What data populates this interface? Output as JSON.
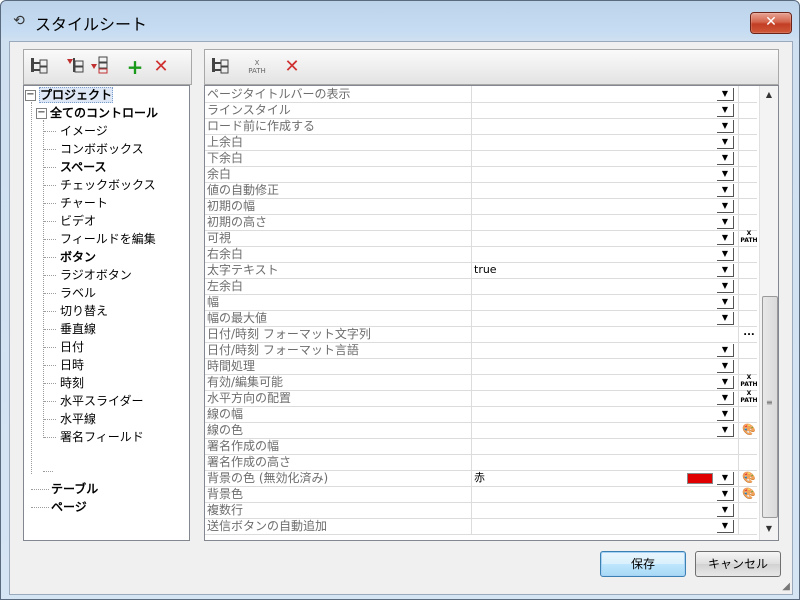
{
  "window": {
    "title": "スタイルシート",
    "close_label": "✕"
  },
  "tree": {
    "root": "プロジェクト",
    "controls_root": "全てのコントロール",
    "controls": [
      "イメージ",
      "コンボボックス",
      "スペース",
      "チェックボックス",
      "チャート",
      "ビデオ",
      "フィールドを編集",
      "ボタン",
      "ラジオボタン",
      "ラベル",
      "切り替え",
      "垂直線",
      "日付",
      "日時",
      "時刻",
      "水平スライダー",
      "水平線",
      "署名フィールド"
    ],
    "bold_controls": [
      "スペース",
      "ボタン"
    ],
    "table": "テーブル",
    "page": "ページ"
  },
  "properties": [
    {
      "name": "ページタイトルバーの表示",
      "value": "",
      "dropdown": true,
      "action": ""
    },
    {
      "name": "ラインスタイル",
      "value": "",
      "dropdown": true,
      "action": ""
    },
    {
      "name": "ロード前に作成する",
      "value": "",
      "dropdown": true,
      "action": ""
    },
    {
      "name": "上余白",
      "value": "",
      "dropdown": true,
      "action": ""
    },
    {
      "name": "下余白",
      "value": "",
      "dropdown": true,
      "action": ""
    },
    {
      "name": "余白",
      "value": "",
      "dropdown": true,
      "action": ""
    },
    {
      "name": "値の自動修正",
      "value": "",
      "dropdown": true,
      "action": ""
    },
    {
      "name": "初期の幅",
      "value": "",
      "dropdown": true,
      "action": ""
    },
    {
      "name": "初期の高さ",
      "value": "",
      "dropdown": true,
      "action": ""
    },
    {
      "name": "可視",
      "value": "",
      "dropdown": true,
      "action": "xpath"
    },
    {
      "name": "右余白",
      "value": "",
      "dropdown": true,
      "action": ""
    },
    {
      "name": "太字テキスト",
      "value": "true",
      "dropdown": true,
      "action": ""
    },
    {
      "name": "左余白",
      "value": "",
      "dropdown": true,
      "action": ""
    },
    {
      "name": "幅",
      "value": "",
      "dropdown": true,
      "action": ""
    },
    {
      "name": "幅の最大値",
      "value": "",
      "dropdown": true,
      "action": ""
    },
    {
      "name": "日付/時刻 フォーマット文字列",
      "value": "",
      "dropdown": false,
      "action": "ellipsis"
    },
    {
      "name": "日付/時刻 フォーマット言語",
      "value": "",
      "dropdown": true,
      "action": ""
    },
    {
      "name": "時間処理",
      "value": "",
      "dropdown": true,
      "action": ""
    },
    {
      "name": "有効/編集可能",
      "value": "",
      "dropdown": true,
      "action": "xpath"
    },
    {
      "name": "水平方向の配置",
      "value": "",
      "dropdown": true,
      "action": "xpath"
    },
    {
      "name": "線の幅",
      "value": "",
      "dropdown": true,
      "action": ""
    },
    {
      "name": "線の色",
      "value": "",
      "dropdown": true,
      "action": "palette"
    },
    {
      "name": "署名作成の幅",
      "value": "",
      "dropdown": false,
      "action": ""
    },
    {
      "name": "署名作成の高さ",
      "value": "",
      "dropdown": false,
      "action": ""
    },
    {
      "name": "背景の色 (無効化済み)",
      "value": "赤",
      "dropdown": true,
      "action": "palette",
      "swatch": "#e00000"
    },
    {
      "name": "背景色",
      "value": "",
      "dropdown": true,
      "action": "palette"
    },
    {
      "name": "複数行",
      "value": "",
      "dropdown": true,
      "action": ""
    },
    {
      "name": "送信ボタンの自動追加",
      "value": "",
      "dropdown": true,
      "action": ""
    }
  ],
  "labels": {
    "xpath": "XPATH",
    "ellipsis": "...",
    "palette": "🎨",
    "dropdown": "▼"
  },
  "buttons": {
    "save": "保存",
    "cancel": "キャンセル"
  },
  "colors": {
    "accent": "#3c7fb1",
    "swatch_red": "#e00000",
    "add_green": "#1a9a1a",
    "delete_red": "#d03030"
  }
}
